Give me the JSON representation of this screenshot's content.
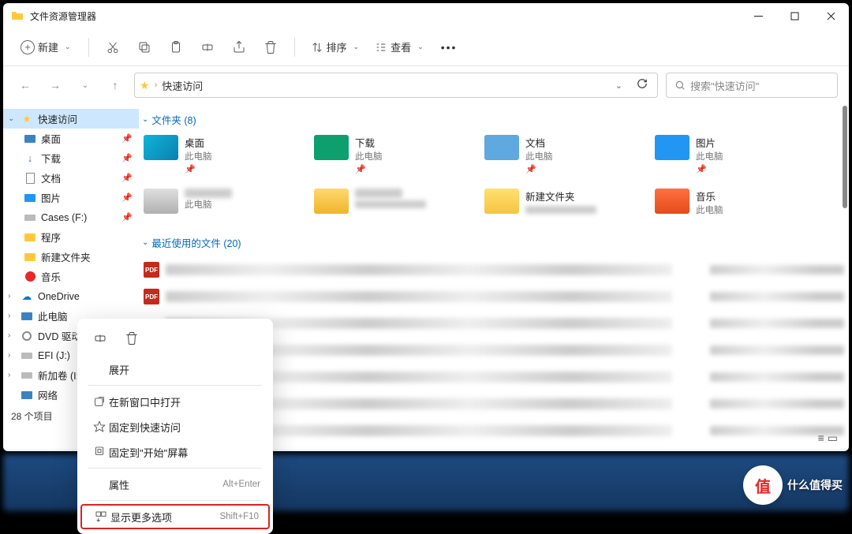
{
  "window": {
    "title": "文件资源管理器"
  },
  "toolbar": {
    "new_label": "新建",
    "sort_label": "排序",
    "view_label": "查看"
  },
  "address": {
    "path": "快速访问",
    "search_placeholder": "搜索\"快速访问\""
  },
  "sidebar": {
    "items": [
      {
        "label": "快速访问",
        "type": "star",
        "chev": "v",
        "sel": true,
        "lvl": 1
      },
      {
        "label": "桌面",
        "type": "desktop",
        "pin": true,
        "lvl": 2
      },
      {
        "label": "下载",
        "type": "download",
        "pin": true,
        "lvl": 2
      },
      {
        "label": "文档",
        "type": "doc",
        "pin": true,
        "lvl": 2
      },
      {
        "label": "图片",
        "type": "pic",
        "pin": true,
        "lvl": 2
      },
      {
        "label": "Cases (F:)",
        "type": "drive",
        "pin": true,
        "lvl": 2
      },
      {
        "label": "程序",
        "type": "folder",
        "lvl": 2
      },
      {
        "label": "新建文件夹",
        "type": "folder",
        "lvl": 2
      },
      {
        "label": "音乐",
        "type": "music",
        "lvl": 2
      },
      {
        "label": "OneDrive",
        "type": "cloud",
        "chev": ">",
        "lvl": 1
      },
      {
        "label": "此电脑",
        "type": "pc",
        "chev": ">",
        "lvl": 1
      },
      {
        "label": "DVD 驱动",
        "type": "dvd",
        "chev": ">",
        "lvl": 1,
        "trunc": true
      },
      {
        "label": "EFI (J:)",
        "type": "drive",
        "chev": ">",
        "lvl": 1
      },
      {
        "label": "新加卷 (I:)",
        "type": "drive",
        "chev": ">",
        "lvl": 1,
        "trunc": true
      },
      {
        "label": "网络",
        "type": "network",
        "lvl": 1
      }
    ],
    "status": "28 个项目"
  },
  "sections": {
    "folders": {
      "title": "文件夹 (8)"
    },
    "recent": {
      "title": "最近使用的文件 (20)"
    }
  },
  "tiles": [
    {
      "name": "桌面",
      "sub": "此电脑",
      "pin": true,
      "color": "ico-desktop"
    },
    {
      "name": "下载",
      "sub": "此电脑",
      "pin": true,
      "color": "ico-dl"
    },
    {
      "name": "文档",
      "sub": "此电脑",
      "pin": true,
      "color": "ico-doc"
    },
    {
      "name": "图片",
      "sub": "此电脑",
      "pin": true,
      "color": "ico-pic"
    },
    {
      "name": "",
      "sub": "此电脑",
      "pin": false,
      "color": "ico-drive",
      "blur": true
    },
    {
      "name": "",
      "sub": "",
      "pin": false,
      "color": "ico-fold",
      "blur": true
    },
    {
      "name": "新建文件夹",
      "sub": "",
      "pin": false,
      "color": "ico-fold2",
      "blur": true,
      "show_name": true
    },
    {
      "name": "音乐",
      "sub": "此电脑",
      "pin": false,
      "color": "ico-music"
    }
  ],
  "context_menu": {
    "items": [
      {
        "label": "展开",
        "icon": "",
        "shortcut": ""
      },
      {
        "label": "在新窗口中打开",
        "icon": "open",
        "shortcut": ""
      },
      {
        "label": "固定到快速访问",
        "icon": "star",
        "shortcut": ""
      },
      {
        "label": "固定到\"开始\"屏幕",
        "icon": "pin",
        "shortcut": ""
      },
      {
        "label": "属性",
        "icon": "",
        "shortcut": "Alt+Enter"
      },
      {
        "label": "显示更多选项",
        "icon": "more",
        "shortcut": "Shift+F10",
        "highlight": true
      }
    ]
  },
  "watermark": {
    "text": "什么值得买",
    "logo": "值"
  }
}
